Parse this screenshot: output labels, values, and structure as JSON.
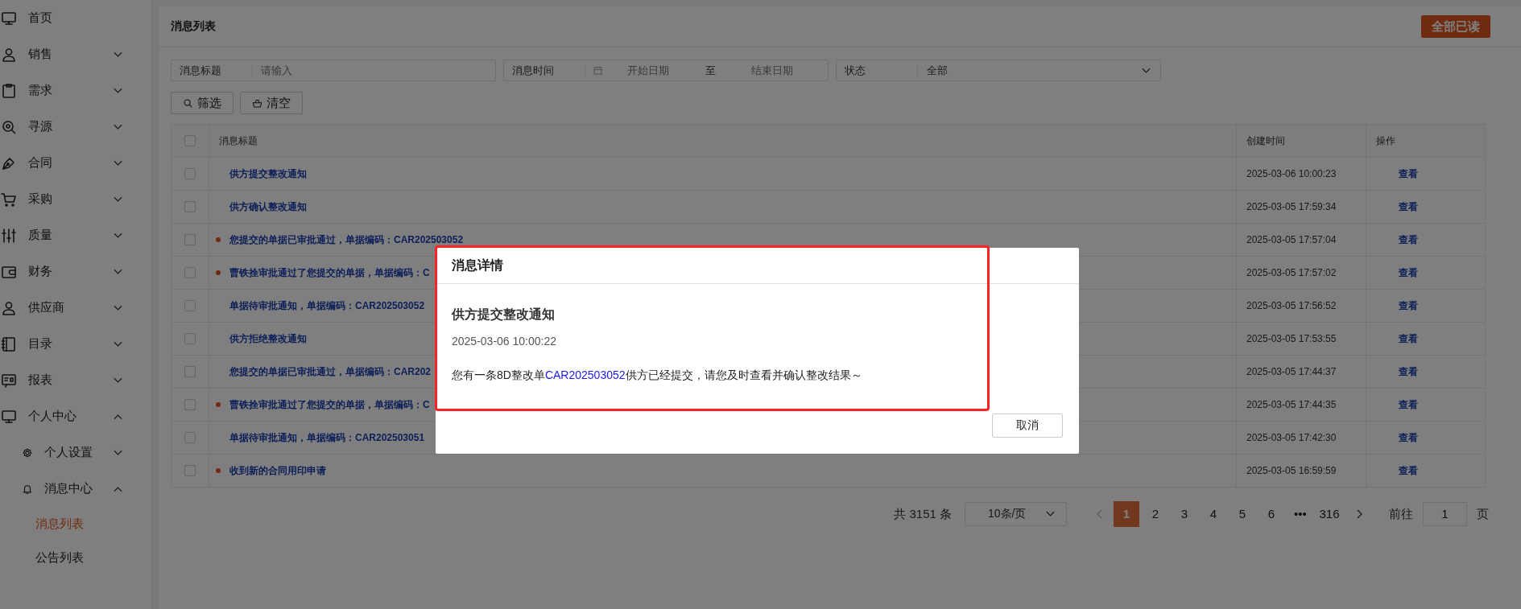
{
  "sidebar": {
    "items": [
      {
        "label": "首页"
      },
      {
        "label": "销售",
        "expanded": false
      },
      {
        "label": "需求",
        "expanded": false
      },
      {
        "label": "寻源",
        "expanded": false
      },
      {
        "label": "合同",
        "expanded": false
      },
      {
        "label": "采购",
        "expanded": false
      },
      {
        "label": "质量",
        "expanded": false
      },
      {
        "label": "财务",
        "expanded": false
      },
      {
        "label": "供应商",
        "expanded": false
      },
      {
        "label": "目录",
        "expanded": false
      },
      {
        "label": "报表",
        "expanded": false
      },
      {
        "label": "个人中心",
        "expanded": true,
        "children": [
          {
            "label": "个人设置",
            "expanded": false
          },
          {
            "label": "消息中心",
            "expanded": true,
            "children": [
              {
                "label": "消息列表",
                "selected": true
              },
              {
                "label": "公告列表",
                "selected": false
              }
            ]
          }
        ]
      }
    ]
  },
  "page": {
    "title": "消息列表",
    "mark_all_read_button": "全部已读"
  },
  "filters": {
    "title_field": {
      "label": "消息标题",
      "placeholder": "请输入"
    },
    "time_field": {
      "label": "消息时间",
      "start_placeholder": "开始日期",
      "separator": "至",
      "end_placeholder": "结束日期"
    },
    "status_field": {
      "label": "状态",
      "value": "全部"
    },
    "buttons": [
      "筛选",
      "清空"
    ]
  },
  "table": {
    "select_all_checked": false,
    "columns": [
      "消息标题",
      "创建时间",
      "操作"
    ],
    "rows": [
      {
        "checked": false,
        "unread": false,
        "title": "供方提交整改通知",
        "time": "2025-03-06 10:00:23",
        "action": "查看"
      },
      {
        "checked": false,
        "unread": false,
        "title": "供方确认整改通知",
        "time": "2025-03-05 17:59:34",
        "action": "查看"
      },
      {
        "checked": false,
        "unread": true,
        "title": "您提交的单据已审批通过，单据编码：CAR202503052",
        "time": "2025-03-05 17:57:04",
        "action": "查看"
      },
      {
        "checked": false,
        "unread": true,
        "title": "曹铁拴审批通过了您提交的单据，单据编码：C",
        "time": "2025-03-05 17:57:02",
        "action": "查看"
      },
      {
        "checked": false,
        "unread": false,
        "title": "单据待审批通知，单据编码：CAR202503052",
        "time": "2025-03-05 17:56:52",
        "action": "查看"
      },
      {
        "checked": false,
        "unread": false,
        "title": "供方拒绝整改通知",
        "time": "2025-03-05 17:53:55",
        "action": "查看"
      },
      {
        "checked": false,
        "unread": false,
        "title": "您提交的单据已审批通过，单据编码：CAR202",
        "time": "2025-03-05 17:44:37",
        "action": "查看"
      },
      {
        "checked": false,
        "unread": true,
        "title": "曹铁拴审批通过了您提交的单据，单据编码：C",
        "time": "2025-03-05 17:44:35",
        "action": "查看"
      },
      {
        "checked": false,
        "unread": false,
        "title": "单据待审批通知，单据编码：CAR202503051",
        "time": "2025-03-05 17:42:30",
        "action": "查看"
      },
      {
        "checked": false,
        "unread": true,
        "title": "收到新的合同用印申请",
        "time": "2025-03-05 16:59:59",
        "action": "查看"
      }
    ]
  },
  "pagination": {
    "total": "共 3151 条",
    "page_size": "10条/页",
    "pages": [
      {
        "label": "1",
        "selected": true
      },
      {
        "label": "2",
        "selected": false
      },
      {
        "label": "3",
        "selected": false
      },
      {
        "label": "4",
        "selected": false
      },
      {
        "label": "5",
        "selected": false
      },
      {
        "label": "6",
        "selected": false
      },
      {
        "label": "•••",
        "selected": false
      },
      {
        "label": "316",
        "selected": false
      }
    ],
    "goto_label": "前往",
    "goto_value": "1",
    "goto_suffix": "页"
  },
  "dialog": {
    "title": "消息详情",
    "message_title": "供方提交整改通知",
    "time": "2025-03-06 10:00:22",
    "body_before": "您有一条8D整改单",
    "body_link": "CAR202503052",
    "body_after": "供方已经提交，请您及时查看并确认整改结果～",
    "cancel_button": "取消"
  }
}
